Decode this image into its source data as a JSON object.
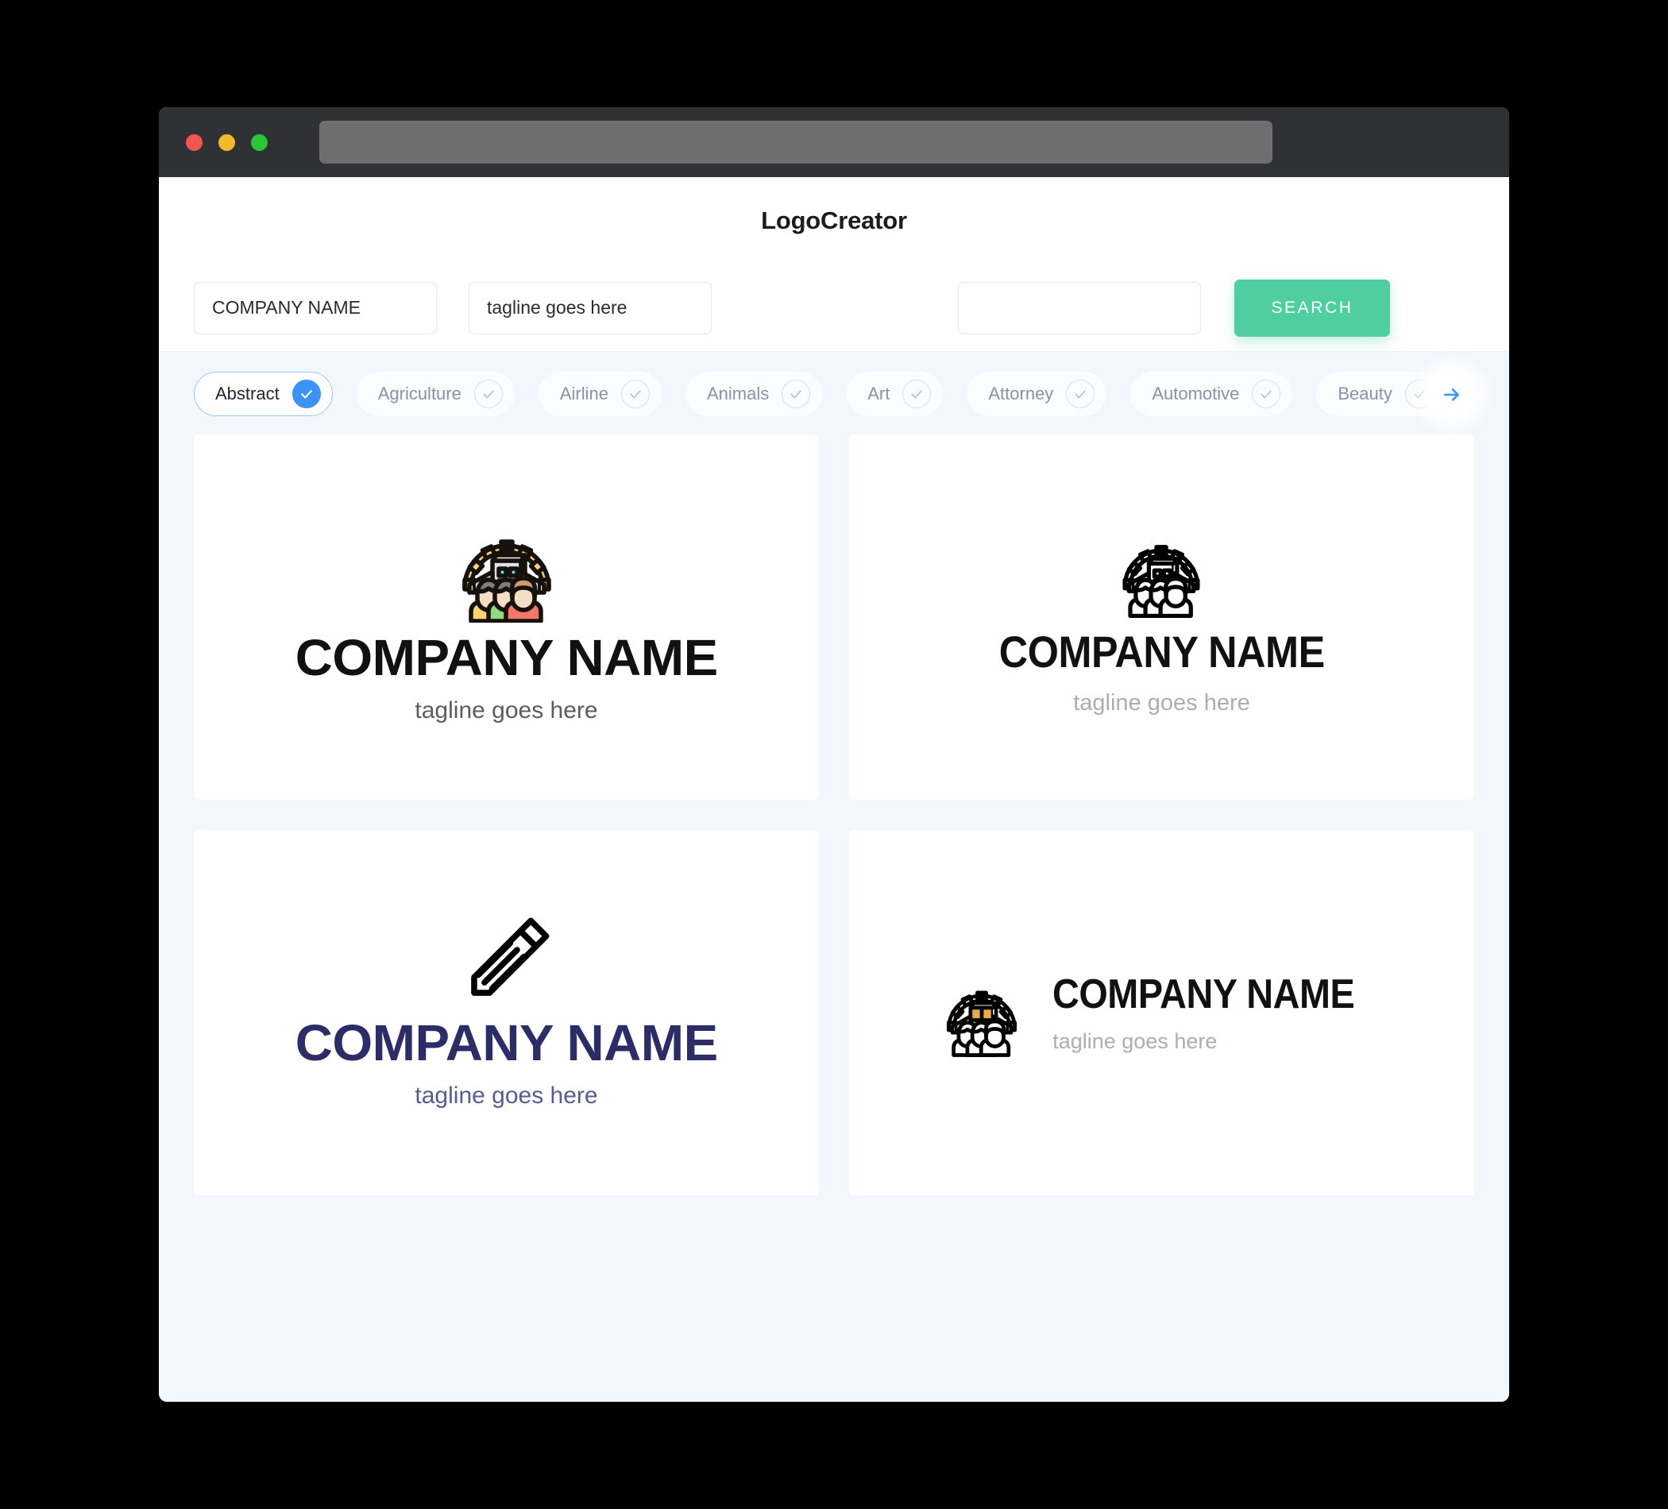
{
  "window": {
    "dots": [
      "close-red",
      "minimize-yellow",
      "maximize-green"
    ],
    "url_value": ""
  },
  "header": {
    "brand": "LogoCreator"
  },
  "search": {
    "company_value": "COMPANY NAME",
    "company_placeholder": "COMPANY NAME",
    "tagline_value": "tagline goes here",
    "tagline_placeholder": "tagline goes here",
    "extra_value": "",
    "extra_placeholder": "",
    "button_label": "SEARCH",
    "button_color": "#4fcfa1"
  },
  "categories": {
    "active_color": "#3b94f5",
    "items": [
      {
        "label": "Abstract",
        "active": true
      },
      {
        "label": "Agriculture",
        "active": false
      },
      {
        "label": "Airline",
        "active": false
      },
      {
        "label": "Animals",
        "active": false
      },
      {
        "label": "Art",
        "active": false
      },
      {
        "label": "Attorney",
        "active": false
      },
      {
        "label": "Automotive",
        "active": false
      },
      {
        "label": "Beauty",
        "active": false
      }
    ],
    "next_icon": "arrow-right-icon"
  },
  "results": [
    {
      "icon": "factory-team-color-icon",
      "company": "COMPANY NAME",
      "tagline": "tagline goes here",
      "name_color": "#111111",
      "tagline_color": "#5c5c5c",
      "layout": "vertical"
    },
    {
      "icon": "factory-team-outline-icon",
      "company": "COMPANY NAME",
      "tagline": "tagline goes here",
      "name_color": "#111111",
      "tagline_color": "#a9aeb5",
      "layout": "vertical"
    },
    {
      "icon": "pencil-icon",
      "company": "COMPANY NAME",
      "tagline": "tagline goes here",
      "name_color": "#2c2c66",
      "tagline_color": "#5b5b90",
      "layout": "vertical"
    },
    {
      "icon": "factory-team-amber-icon",
      "company": "COMPANY NAME",
      "tagline": "tagline goes here",
      "name_color": "#111111",
      "tagline_color": "#a9aeb5",
      "layout": "horizontal"
    }
  ]
}
